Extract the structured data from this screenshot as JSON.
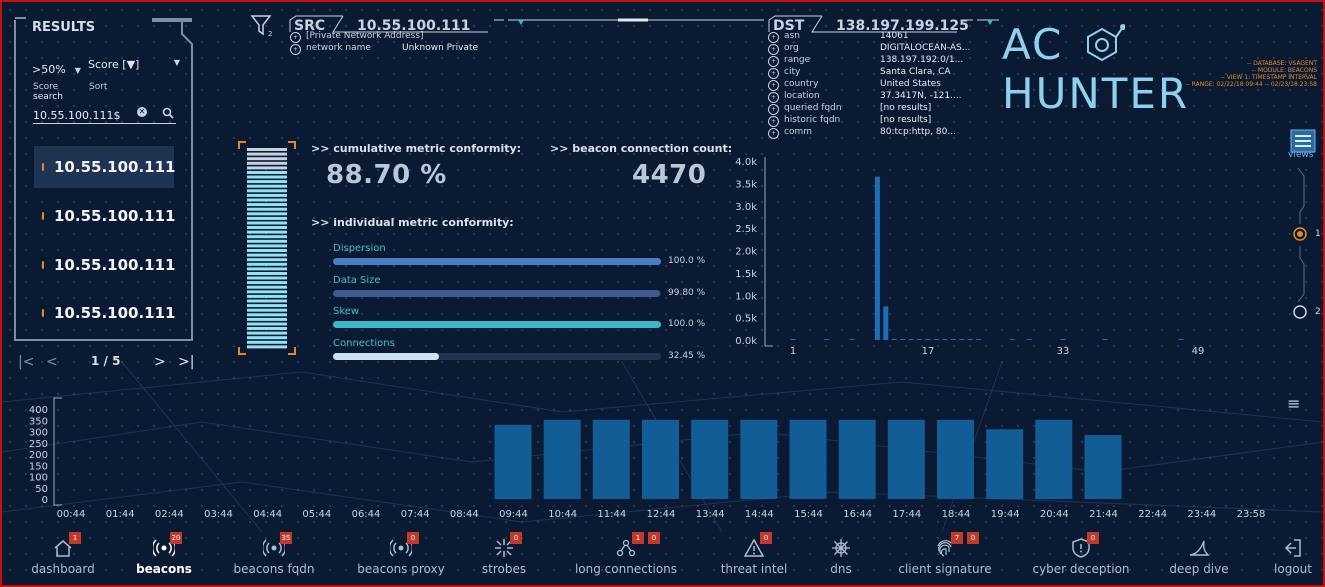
{
  "results": {
    "title": "RESULTS",
    "score_filter": ">50%",
    "score_caption": "Score",
    "sort_value": "Score [▼]",
    "sort_caption": "Sort",
    "search_label": "search",
    "search_value": "10.55.100.111$",
    "items": [
      "10.55.100.111",
      "10.55.100.111",
      "10.55.100.111",
      "10.55.100.111"
    ],
    "pager": {
      "text": "1 / 5"
    }
  },
  "filter_badge": "2",
  "src": {
    "label": "SRC",
    "ip": "10.55.100.111",
    "rows": [
      {
        "key": "[Private Network Address]",
        "value": ""
      },
      {
        "key": "network name",
        "value": "Unknown Private"
      }
    ]
  },
  "dst": {
    "label": "DST",
    "ip": "138.197.199.125",
    "rows": [
      {
        "key": "asn",
        "value": "14061"
      },
      {
        "key": "org",
        "value": "DIGITALOCEAN-AS..."
      },
      {
        "key": "range",
        "value": "138.197.192.0/1..."
      },
      {
        "key": "city",
        "value": "Santa Clara, CA"
      },
      {
        "key": "country",
        "value": "United States"
      },
      {
        "key": "location",
        "value": "37.3417N, -121...."
      },
      {
        "key": "queried fqdn",
        "value": "[no results]"
      },
      {
        "key": "historic fqdn",
        "value": "[no results]"
      },
      {
        "key": "comm",
        "value": "80:tcp:http, 80..."
      }
    ]
  },
  "brand": {
    "logo_left": "AC",
    "logo_right": "HUNTER",
    "meta": [
      "-- DATABASE: VSAGENT",
      "-- MODULE: BEACONS",
      "-- VIEW 1: TIMESTAMP INTERVAL",
      "-- RANGE: 02/22/18 09:44 -- 02/23/18 23:58"
    ]
  },
  "metrics": {
    "cumulative_label": ">> cumulative metric conformity:",
    "cumulative_value": "88.70 %",
    "count_label": ">> beacon connection count:",
    "count_value": "4470",
    "individual_label": ">> individual metric conformity:",
    "items": [
      {
        "name": "Dispersion",
        "value": 100.0,
        "display": "100.0 %",
        "color": "#4a7cc7"
      },
      {
        "name": "Data Size",
        "value": 99.8,
        "display": "99.80 %",
        "color": "#3d5a8f"
      },
      {
        "name": "Skew",
        "value": 100.0,
        "display": "100.0 %",
        "color": "#3ab7c8"
      },
      {
        "name": "Connections",
        "value": 32.45,
        "display": "32.45 %",
        "color": "#c9e3f2"
      }
    ]
  },
  "views": {
    "label": "views",
    "options": [
      "1",
      "2"
    ],
    "selected": "1"
  },
  "chart_data": [
    {
      "type": "bar",
      "title": "",
      "y_ticks": [
        "0.0k",
        "0.5k",
        "1.0k",
        "1.5k",
        "2.0k",
        "2.5k",
        "3.0k",
        "3.5k",
        "4.0k"
      ],
      "x_tick_labels": [
        "1",
        "17",
        "33",
        "49"
      ],
      "ylim": [
        0,
        4000
      ],
      "x": [
        1,
        5,
        8,
        11,
        12,
        13,
        14,
        15,
        16,
        17,
        18,
        19,
        20,
        21,
        22,
        23,
        27,
        29,
        33,
        38,
        47
      ],
      "values": [
        10,
        10,
        10,
        3650,
        750,
        25,
        15,
        15,
        15,
        15,
        15,
        15,
        10,
        10,
        10,
        10,
        10,
        10,
        10,
        10,
        10
      ]
    },
    {
      "type": "bar",
      "title": "",
      "y_ticks": [
        "0",
        "50",
        "100",
        "150",
        "200",
        "250",
        "300",
        "350",
        "400"
      ],
      "categories": [
        "00:44",
        "01:44",
        "02:44",
        "03:44",
        "04:44",
        "05:44",
        "06:44",
        "07:44",
        "08:44",
        "09:44",
        "10:44",
        "11:44",
        "12:44",
        "13:44",
        "14:44",
        "15:44",
        "16:44",
        "17:44",
        "18:44",
        "19:44",
        "20:44",
        "21:44",
        "22:44",
        "23:44",
        "23:58"
      ],
      "ylim": [
        0,
        400
      ],
      "values": [
        0,
        0,
        0,
        0,
        0,
        0,
        0,
        0,
        0,
        330,
        352,
        352,
        352,
        352,
        352,
        352,
        352,
        352,
        352,
        310,
        352,
        284,
        0,
        0,
        0
      ]
    }
  ],
  "nav": [
    {
      "label": "dashboard",
      "icon": "house-icon",
      "badges": [
        "1"
      ],
      "active": false
    },
    {
      "label": "beacons",
      "icon": "beacon-icon",
      "badges": [
        "20"
      ],
      "active": true
    },
    {
      "label": "beacons fqdn",
      "icon": "beacon-fqdn-icon",
      "badges": [
        "35"
      ],
      "active": false
    },
    {
      "label": "beacons proxy",
      "icon": "beacon-proxy-icon",
      "badges": [
        "0"
      ],
      "active": false
    },
    {
      "label": "strobes",
      "icon": "strobe-icon",
      "badges": [
        "0"
      ],
      "active": false
    },
    {
      "label": "long connections",
      "icon": "network-icon",
      "badges": [
        "1",
        "0"
      ],
      "active": false
    },
    {
      "label": "threat intel",
      "icon": "warning-icon",
      "badges": [
        "0"
      ],
      "active": false
    },
    {
      "label": "dns",
      "icon": "helm-icon",
      "badges": [],
      "active": false
    },
    {
      "label": "client signature",
      "icon": "fingerprint-icon",
      "badges": [
        "7",
        "0"
      ],
      "active": false
    },
    {
      "label": "cyber deception",
      "icon": "shield-icon",
      "badges": [
        "0"
      ],
      "active": false
    },
    {
      "label": "deep dive",
      "icon": "fin-icon",
      "badges": [],
      "active": false
    },
    {
      "label": "logout",
      "icon": "logout-icon",
      "badges": [],
      "active": false
    }
  ]
}
